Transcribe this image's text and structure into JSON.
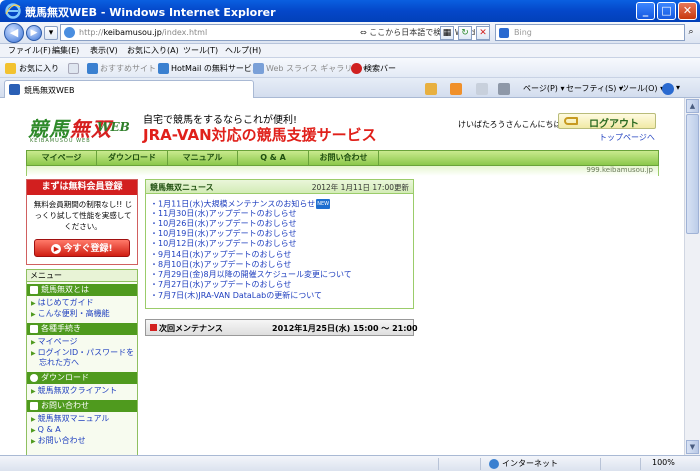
{
  "window": {
    "title": "競馬無双WEB - Windows Internet Explorer",
    "minimize": "_",
    "maximize": "□",
    "close": "✕"
  },
  "address": {
    "url_prefix": "http://",
    "url_host": "keibamusou.jp",
    "url_path": "/index.html",
    "hint": "ここから日本語で検索(JWord)",
    "search_placeholder": "Bing"
  },
  "menu": {
    "items": [
      "ファイル(F)",
      "編集(E)",
      "表示(V)",
      "お気に入り(A)",
      "ツール(T)",
      "ヘルプ(H)"
    ]
  },
  "favorites": {
    "label": "お気に入り",
    "items": [
      "おすすめサイト ▾",
      "HotMail の無料サービス",
      "Web スライス ギャラリー ▾",
      "検索バー"
    ]
  },
  "tab": {
    "label": "競馬無双WEB"
  },
  "toolbar": {
    "page": "ページ(P) ▾",
    "safety": "セーフティ(S) ▾",
    "tools": "ツール(O) ▾",
    "help": "▾"
  },
  "site": {
    "logo_main": "競馬",
    "logo_accent": "無双",
    "logo_web": "WEB",
    "logo_sub": "KEIBAMUSOU WEB",
    "tagline": "自宅で競馬をするならこれが便利!",
    "headline": "JRA-VAN対応の競馬支援サービス",
    "greeting": "けいばたろうさんこんにちは",
    "login_label": "ログアウト",
    "toppage_label": "トップページへ",
    "domain": "999.keibamusou.jp",
    "nav": [
      "マイページ",
      "ダウンロード",
      "マニュアル",
      "Q & A",
      "お問い合わせ"
    ]
  },
  "signup": {
    "title": "まずは無料会員登録",
    "text": "無料会員期間の制限なし!! じっくり試して性能を実感してください。",
    "button": "今すぐ登録!"
  },
  "sidemenu": {
    "header": "メニュー",
    "sections": [
      {
        "title": "競馬無双とは",
        "links": [
          "はじめてガイド",
          "こんな便利・高機能"
        ]
      },
      {
        "title": "各種手続き",
        "links": [
          "マイページ",
          "ログインID・パスワードを",
          "忘れた方へ"
        ]
      },
      {
        "title": "ダウンロード",
        "links": [
          "競馬無双クライアント"
        ]
      },
      {
        "title": "お問い合わせ",
        "links": [
          "競馬無双マニュアル",
          "Q & A",
          "お問い合わせ"
        ]
      }
    ]
  },
  "news": {
    "title": "競馬無双ニュース",
    "updated": "2012年 1月11日 17:00更新",
    "new_badge": "NEW",
    "items": [
      "1月11日(水)大規模メンテナンスのお知らせ",
      "11月30日(水)アップデートのおしらせ",
      "10月26日(水)アップデートのおしらせ",
      "10月19日(水)アップデートのおしらせ",
      "10月12日(水)アップデートのおしらせ",
      "9月14日(水)アップデートのおしらせ",
      "8月10日(水)アップデートのおしらせ",
      "7月29日(金)8月以降の開催スケジュール変更について",
      "7月27日(水)アップデートのおしらせ",
      "7月7日(木)JRA-VAN DataLabの更新について"
    ]
  },
  "maintenance": {
    "title": "次回メンテナンス",
    "value": "2012年1月25日(水) 15:00 ～ 21:00"
  },
  "status": {
    "zone": "インターネット",
    "zoom": "100%"
  }
}
